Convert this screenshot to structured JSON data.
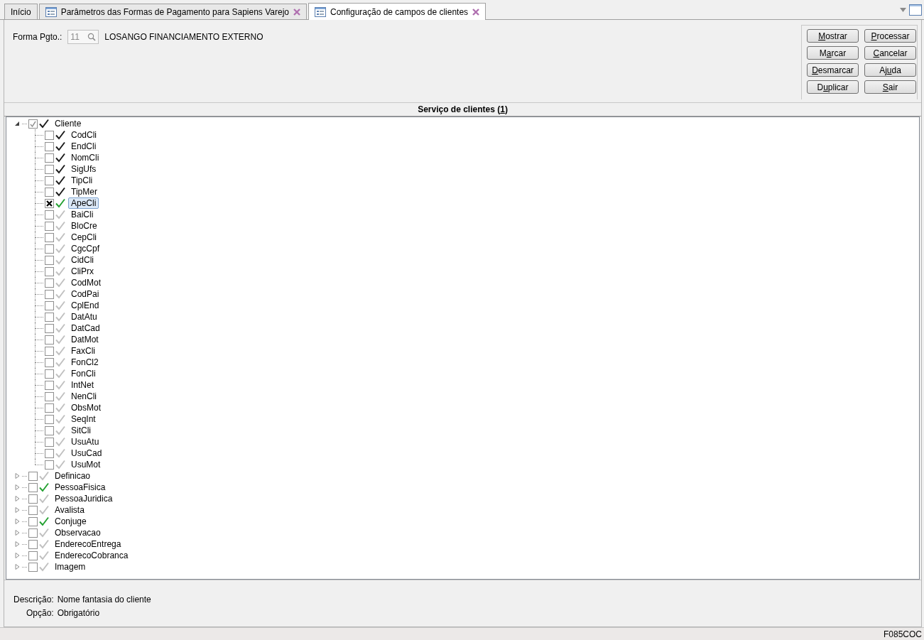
{
  "tabs": [
    {
      "label": "Início",
      "icon": false,
      "closable": false,
      "selected": false
    },
    {
      "label": "Parâmetros das Formas de Pagamento para Sapiens Varejo",
      "icon": true,
      "closable": true,
      "selected": false
    },
    {
      "label": "Configuração de campos de clientes",
      "icon": true,
      "closable": true,
      "selected": true
    }
  ],
  "form": {
    "label": "Forma Pgto.:",
    "value": "11",
    "disabled": true,
    "description": "LOSANGO FINANCIAMENTO EXTERNO"
  },
  "buttons": [
    {
      "key": "M",
      "post": "ostrar"
    },
    {
      "key": "P",
      "post": "rocessar"
    },
    {
      "pre": "M",
      "key": "a",
      "post": "rcar"
    },
    {
      "key": "C",
      "post": "ancelar"
    },
    {
      "key": "D",
      "post": "esmarcar"
    },
    {
      "pre": "Aj",
      "key": "u",
      "post": "da"
    },
    {
      "pre": "D",
      "key": "u",
      "post": "plicar"
    },
    {
      "key": "S",
      "post": "air"
    }
  ],
  "section": {
    "pre": "Serviço de clientes (",
    "key": "1",
    "post": ")"
  },
  "tree": [
    {
      "label": "Cliente",
      "expanded": true,
      "checked": true,
      "crossed": false,
      "color": "#1a1a1a",
      "selected": false,
      "children": [
        {
          "label": "CodCli",
          "checked": false,
          "crossed": false,
          "color": "#1a1a1a",
          "selected": false
        },
        {
          "label": "EndCli",
          "checked": false,
          "crossed": false,
          "color": "#1a1a1a",
          "selected": false
        },
        {
          "label": "NomCli",
          "checked": false,
          "crossed": false,
          "color": "#1a1a1a",
          "selected": false
        },
        {
          "label": "SigUfs",
          "checked": false,
          "crossed": false,
          "color": "#1a1a1a",
          "selected": false
        },
        {
          "label": "TipCli",
          "checked": false,
          "crossed": false,
          "color": "#1a1a1a",
          "selected": false
        },
        {
          "label": "TipMer",
          "checked": false,
          "crossed": false,
          "color": "#1a1a1a",
          "selected": false
        },
        {
          "label": "ApeCli",
          "checked": false,
          "crossed": true,
          "color": "#22a030",
          "selected": true
        },
        {
          "label": "BaiCli",
          "checked": false,
          "crossed": false,
          "color": "#c0c0c0",
          "selected": false
        },
        {
          "label": "BloCre",
          "checked": false,
          "crossed": false,
          "color": "#c0c0c0",
          "selected": false
        },
        {
          "label": "CepCli",
          "checked": false,
          "crossed": false,
          "color": "#c0c0c0",
          "selected": false
        },
        {
          "label": "CgcCpf",
          "checked": false,
          "crossed": false,
          "color": "#c0c0c0",
          "selected": false
        },
        {
          "label": "CidCli",
          "checked": false,
          "crossed": false,
          "color": "#c0c0c0",
          "selected": false
        },
        {
          "label": "CliPrx",
          "checked": false,
          "crossed": false,
          "color": "#c0c0c0",
          "selected": false
        },
        {
          "label": "CodMot",
          "checked": false,
          "crossed": false,
          "color": "#c0c0c0",
          "selected": false
        },
        {
          "label": "CodPai",
          "checked": false,
          "crossed": false,
          "color": "#c0c0c0",
          "selected": false
        },
        {
          "label": "CplEnd",
          "checked": false,
          "crossed": false,
          "color": "#c0c0c0",
          "selected": false
        },
        {
          "label": "DatAtu",
          "checked": false,
          "crossed": false,
          "color": "#c0c0c0",
          "selected": false
        },
        {
          "label": "DatCad",
          "checked": false,
          "crossed": false,
          "color": "#c0c0c0",
          "selected": false
        },
        {
          "label": "DatMot",
          "checked": false,
          "crossed": false,
          "color": "#c0c0c0",
          "selected": false
        },
        {
          "label": "FaxCli",
          "checked": false,
          "crossed": false,
          "color": "#c0c0c0",
          "selected": false
        },
        {
          "label": "FonCl2",
          "checked": false,
          "crossed": false,
          "color": "#c0c0c0",
          "selected": false
        },
        {
          "label": "FonCli",
          "checked": false,
          "crossed": false,
          "color": "#c0c0c0",
          "selected": false
        },
        {
          "label": "IntNet",
          "checked": false,
          "crossed": false,
          "color": "#c0c0c0",
          "selected": false
        },
        {
          "label": "NenCli",
          "checked": false,
          "crossed": false,
          "color": "#c0c0c0",
          "selected": false
        },
        {
          "label": "ObsMot",
          "checked": false,
          "crossed": false,
          "color": "#c0c0c0",
          "selected": false
        },
        {
          "label": "SeqInt",
          "checked": false,
          "crossed": false,
          "color": "#c0c0c0",
          "selected": false
        },
        {
          "label": "SitCli",
          "checked": false,
          "crossed": false,
          "color": "#c0c0c0",
          "selected": false
        },
        {
          "label": "UsuAtu",
          "checked": false,
          "crossed": false,
          "color": "#c0c0c0",
          "selected": false
        },
        {
          "label": "UsuCad",
          "checked": false,
          "crossed": false,
          "color": "#c0c0c0",
          "selected": false
        },
        {
          "label": "UsuMot",
          "checked": false,
          "crossed": false,
          "color": "#c0c0c0",
          "selected": false
        }
      ]
    },
    {
      "label": "Definicao",
      "expanded": false,
      "checked": false,
      "crossed": false,
      "color": "#c0c0c0",
      "selected": false
    },
    {
      "label": "PessoaFisica",
      "expanded": false,
      "checked": false,
      "crossed": false,
      "color": "#22a030",
      "selected": false
    },
    {
      "label": "PessoaJuridica",
      "expanded": false,
      "checked": false,
      "crossed": false,
      "color": "#c0c0c0",
      "selected": false
    },
    {
      "label": "Avalista",
      "expanded": false,
      "checked": false,
      "crossed": false,
      "color": "#c0c0c0",
      "selected": false
    },
    {
      "label": "Conjuge",
      "expanded": false,
      "checked": false,
      "crossed": false,
      "color": "#22a030",
      "selected": false
    },
    {
      "label": "Observacao",
      "expanded": false,
      "checked": false,
      "crossed": false,
      "color": "#c0c0c0",
      "selected": false
    },
    {
      "label": "EnderecoEntrega",
      "expanded": false,
      "checked": false,
      "crossed": false,
      "color": "#c0c0c0",
      "selected": false
    },
    {
      "label": "EnderecoCobranca",
      "expanded": false,
      "checked": false,
      "crossed": false,
      "color": "#c0c0c0",
      "selected": false
    },
    {
      "label": "Imagem",
      "expanded": false,
      "checked": false,
      "crossed": false,
      "color": "#c0c0c0",
      "selected": false
    }
  ],
  "details": [
    {
      "label": "Descrição:",
      "value": "Nome fantasia do cliente"
    },
    {
      "label": "Opção:",
      "value": "Obrigatório"
    }
  ],
  "status_bar": {
    "code": "F085COC"
  }
}
